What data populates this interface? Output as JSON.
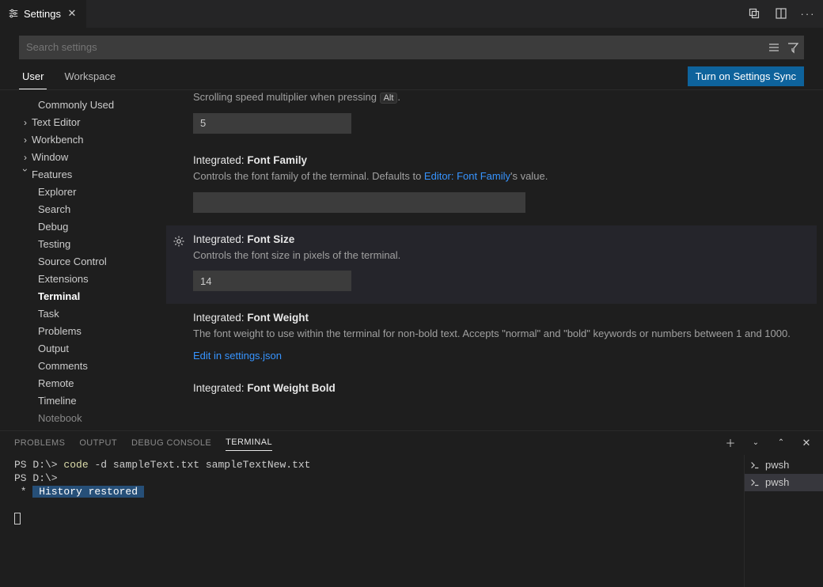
{
  "tab": {
    "title": "Settings"
  },
  "search": {
    "placeholder": "Search settings"
  },
  "scope": {
    "user": "User",
    "workspace": "Workspace",
    "sync": "Turn on Settings Sync"
  },
  "toc": {
    "commonly_used": "Commonly Used",
    "text_editor": "Text Editor",
    "workbench": "Workbench",
    "window": "Window",
    "features": "Features",
    "children": {
      "explorer": "Explorer",
      "search": "Search",
      "debug": "Debug",
      "testing": "Testing",
      "source_control": "Source Control",
      "extensions": "Extensions",
      "terminal": "Terminal",
      "task": "Task",
      "problems": "Problems",
      "output": "Output",
      "comments": "Comments",
      "remote": "Remote",
      "timeline": "Timeline",
      "notebook": "Notebook"
    }
  },
  "settings": {
    "altMultiplier": {
      "desc_pre": "Scrolling speed multiplier when pressing ",
      "kbd": "Alt",
      "desc_post": ".",
      "value": "5"
    },
    "fontFamily": {
      "prefix": "Integrated: ",
      "name": "Font Family",
      "desc_pre": "Controls the font family of the terminal. Defaults to ",
      "link": "Editor: Font Family",
      "desc_post": "'s value.",
      "value": ""
    },
    "fontSize": {
      "prefix": "Integrated: ",
      "name": "Font Size",
      "desc": "Controls the font size in pixels of the terminal.",
      "value": "14"
    },
    "fontWeight": {
      "prefix": "Integrated: ",
      "name": "Font Weight",
      "desc": "The font weight to use within the terminal for non-bold text. Accepts \"normal\" and \"bold\" keywords or numbers between 1 and 1000.",
      "link": "Edit in settings.json"
    },
    "fontWeightBold": {
      "prefix": "Integrated: ",
      "name": "Font Weight Bold"
    }
  },
  "panel": {
    "tabs": {
      "problems": "Problems",
      "output": "Output",
      "debug": "Debug Console",
      "terminal": "Terminal"
    },
    "terminals": {
      "a": "pwsh",
      "b": "pwsh"
    },
    "lines": {
      "l1_prompt": "PS D:\\> ",
      "l1_cmd": "code",
      "l1_rest": " -d sampleText.txt sampleTextNew.txt",
      "l2": "PS D:\\>",
      "l3_star": " * ",
      "l3_hist": " History restored "
    }
  }
}
